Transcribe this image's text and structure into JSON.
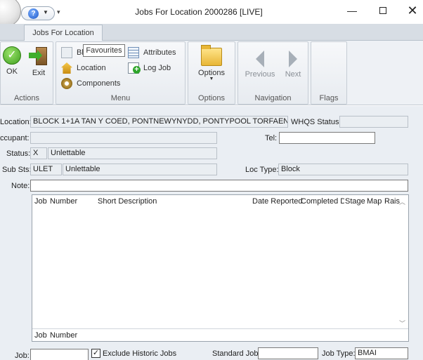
{
  "window": {
    "title": "Jobs For Location 2000286 [LIVE]"
  },
  "qat": {
    "help_icon": "question-icon"
  },
  "ribbon": {
    "tab": "Jobs For Location",
    "actions": {
      "label": "Actions",
      "ok": "OK",
      "exit": "Exit"
    },
    "menu": {
      "label": "Menu",
      "blank": "Bl",
      "location": "Location",
      "components": "Components",
      "attributes": "Attributes",
      "log_job": "Log Job"
    },
    "options": {
      "label": "Options",
      "button": "Options"
    },
    "navigation": {
      "label": "Navigation",
      "previous": "Previous",
      "next": "Next"
    },
    "flags": {
      "label": "Flags"
    },
    "tooltip": "Favourites"
  },
  "form": {
    "location_label": "Location:",
    "location_value": "BLOCK 1+1A TAN Y COED, PONTNEWYNYDD, PONTYPOOL TORFAEN",
    "whqs_label": "WHQS Status:",
    "whqs_value": "",
    "occupant_label": "ccupant:",
    "occupant_value": "",
    "tel_label": "Tel:",
    "tel_value": "",
    "status_label": "Status:",
    "status_code": "X",
    "status_value": "Unlettable",
    "substs_label": "Sub Sts:",
    "substs_code": "ULET",
    "substs_value": "Unlettable",
    "loctype_label": "Loc Type:",
    "loctype_value": "Block",
    "note_label": "Note:",
    "note_value": "",
    "grid_columns": [
      "Job",
      "Number",
      "Short Description",
      "Date Reported",
      "Completed D",
      "Stage",
      "Map",
      "Rais"
    ],
    "grid_footer": [
      "Job",
      "Number"
    ],
    "job_label": "Job:",
    "job_value": "",
    "exclude_label": "Exclude Historic Jobs",
    "exclude_checked": "✓",
    "standard_job_label": "Standard Job:",
    "standard_job_value": "",
    "job_type_label": "Job Type:",
    "job_type_value": "BMAI"
  }
}
